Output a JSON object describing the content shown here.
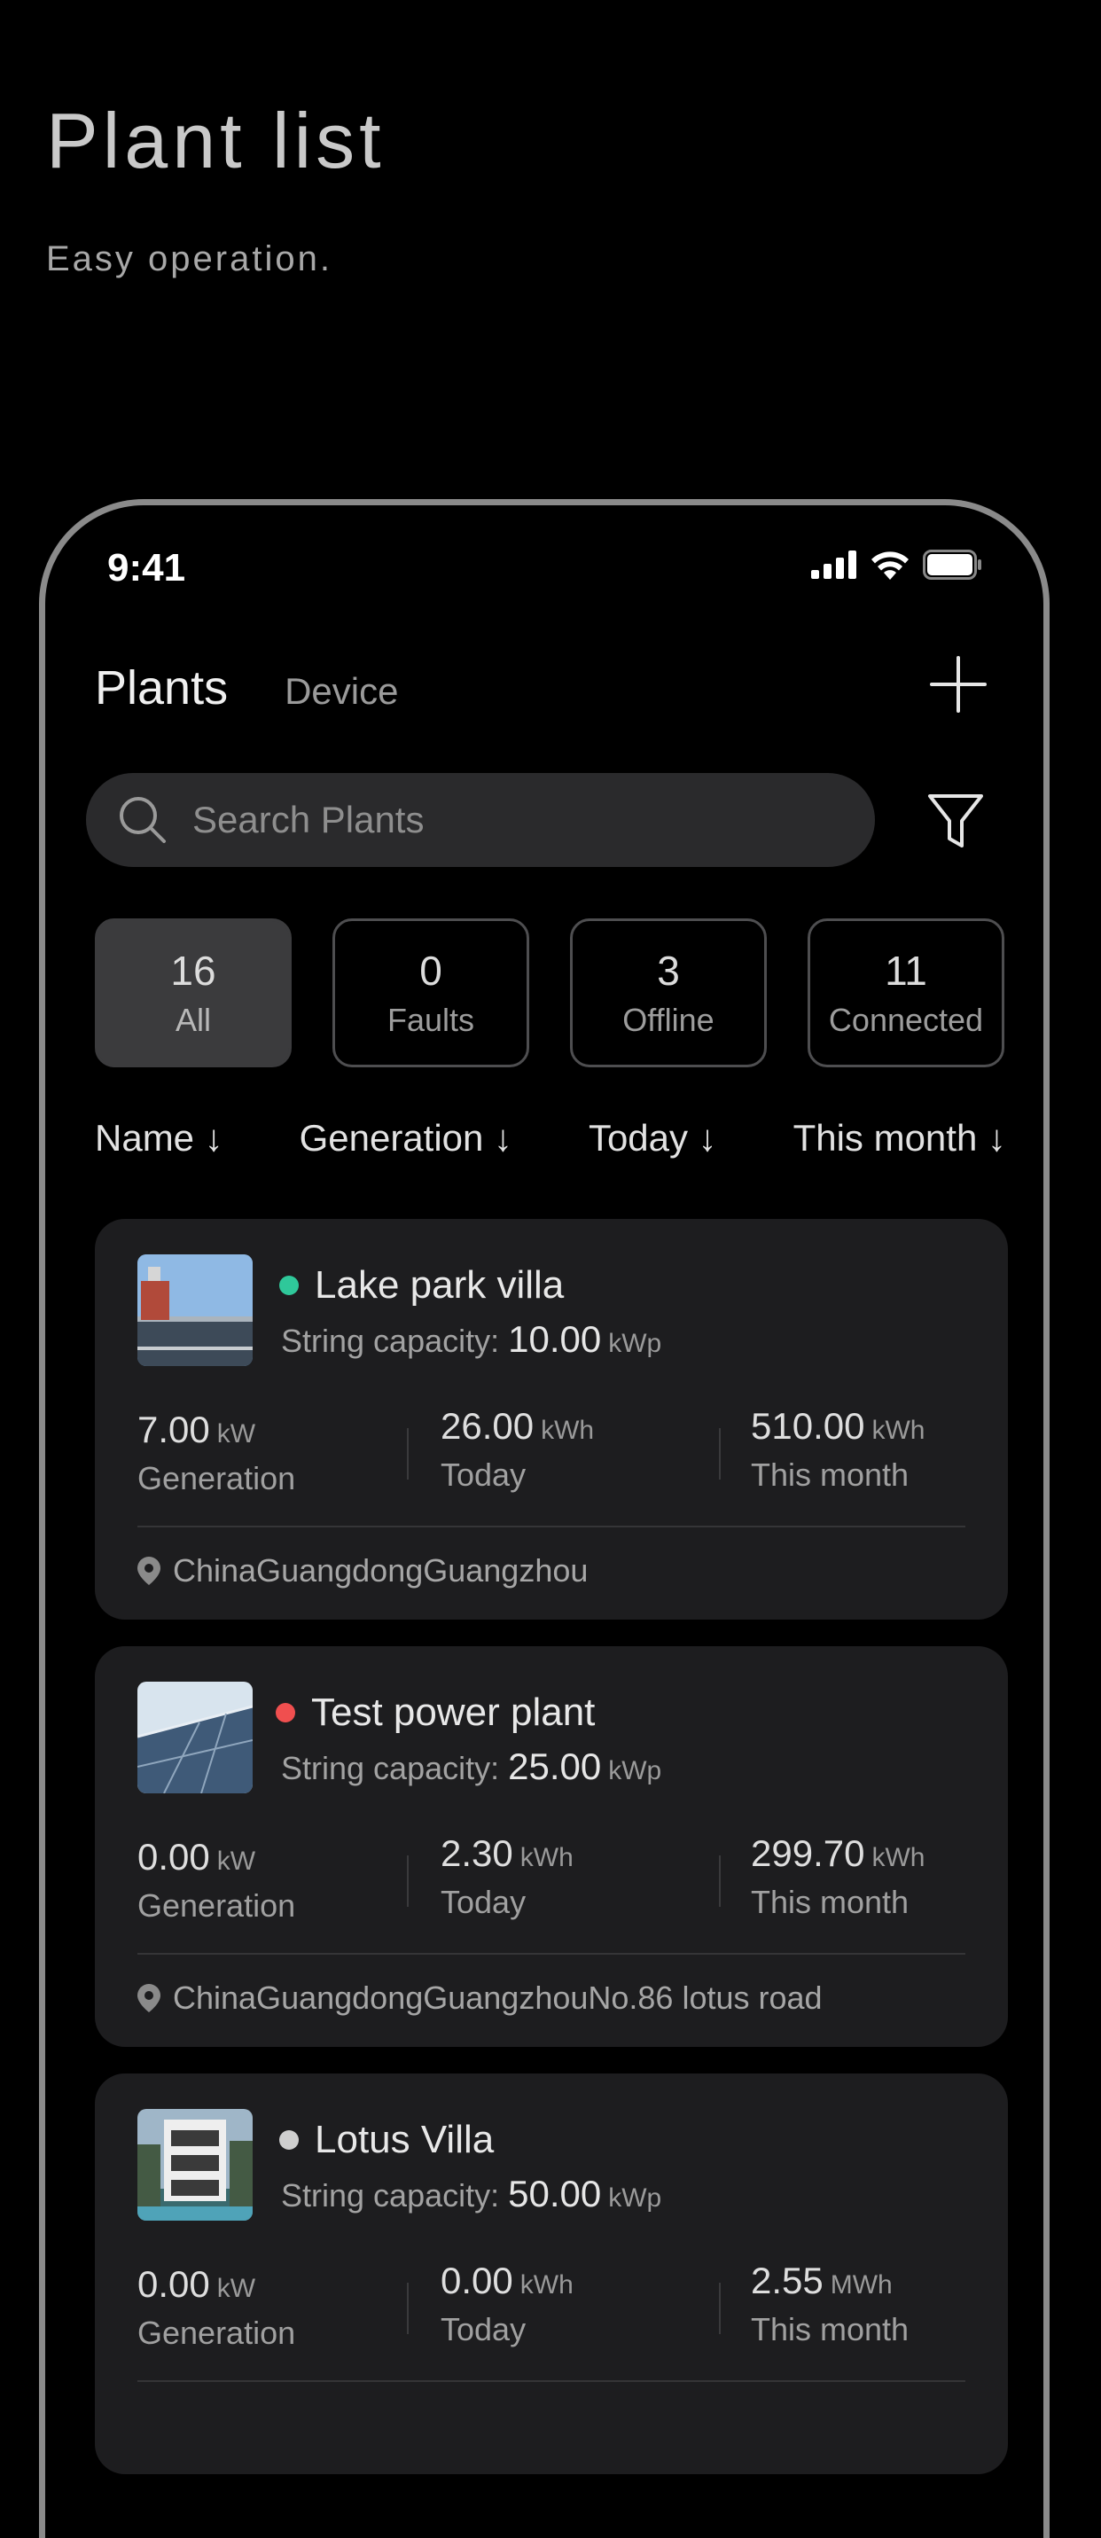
{
  "hero": {
    "title": "Plant list",
    "subtitle": "Easy operation."
  },
  "status_bar": {
    "time": "9:41"
  },
  "nav": {
    "tab_plants": "Plants",
    "tab_device": "Device"
  },
  "search": {
    "placeholder": "Search Plants"
  },
  "stats": [
    {
      "count": "16",
      "label": "All",
      "active": true
    },
    {
      "count": "0",
      "label": "Faults"
    },
    {
      "count": "3",
      "label": "Offline"
    },
    {
      "count": "11",
      "label": "Connected"
    }
  ],
  "sort": [
    "Name ↓",
    "Generation ↓",
    "Today ↓",
    "This month ↓"
  ],
  "plants": [
    {
      "name": "Lake park villa",
      "status_color": "#2fc89a",
      "capacity_label": "String capacity:",
      "capacity": "10.00",
      "capacity_unit": "kWp",
      "generation": "7.00",
      "generation_unit": "kW",
      "generation_label": "Generation",
      "today": "26.00",
      "today_unit": "kWh",
      "today_label": "Today",
      "month": "510.00",
      "month_unit": "kWh",
      "month_label": "This month",
      "location": "ChinaGuangdongGuangzhou"
    },
    {
      "name": "Test power plant",
      "status_color": "#f04f4f",
      "capacity_label": "String capacity:",
      "capacity": "25.00",
      "capacity_unit": "kWp",
      "generation": "0.00",
      "generation_unit": "kW",
      "generation_label": "Generation",
      "today": "2.30",
      "today_unit": "kWh",
      "today_label": "Today",
      "month": "299.70",
      "month_unit": "kWh",
      "month_label": "This month",
      "location": "ChinaGuangdongGuangzhouNo.86 lotus road"
    },
    {
      "name": "Lotus Villa",
      "status_color": "#cfcfcf",
      "capacity_label": "String capacity:",
      "capacity": "50.00",
      "capacity_unit": "kWp",
      "generation": "0.00",
      "generation_unit": "kW",
      "generation_label": "Generation",
      "today": "0.00",
      "today_unit": "kWh",
      "today_label": "Today",
      "month": "2.55",
      "month_unit": "MWh",
      "month_label": "This month"
    }
  ],
  "colors": {
    "background": "#000000",
    "card": "#1d1d1f",
    "online": "#2fc89a",
    "fault": "#f04f4f",
    "offline": "#cfcfcf"
  }
}
